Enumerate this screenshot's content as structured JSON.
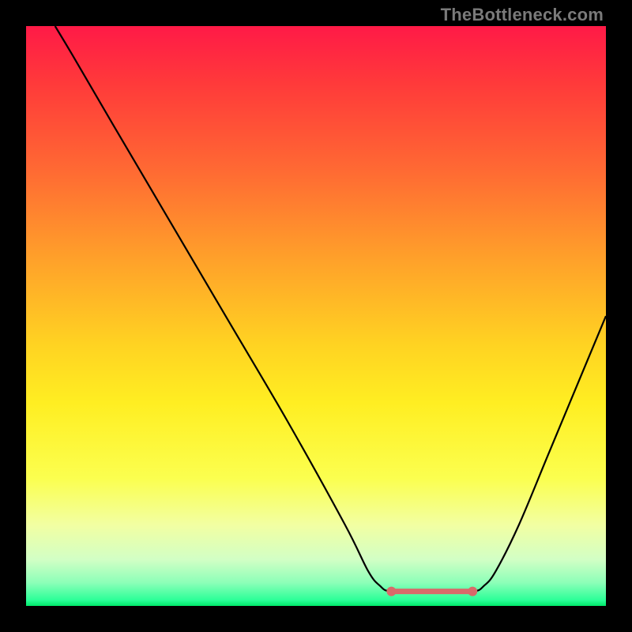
{
  "attribution": "TheBottleneck.com",
  "chart_data": {
    "type": "line",
    "title": "",
    "xlabel": "",
    "ylabel": "",
    "xlim": [
      0,
      100
    ],
    "ylim": [
      0,
      100
    ],
    "curve": [
      {
        "x": 5,
        "y": 100
      },
      {
        "x": 8,
        "y": 95
      },
      {
        "x": 15,
        "y": 83
      },
      {
        "x": 25,
        "y": 66
      },
      {
        "x": 35,
        "y": 49
      },
      {
        "x": 45,
        "y": 32
      },
      {
        "x": 55,
        "y": 14
      },
      {
        "x": 59,
        "y": 6
      },
      {
        "x": 61,
        "y": 3.5
      },
      {
        "x": 63,
        "y": 2.5
      },
      {
        "x": 70,
        "y": 2.5
      },
      {
        "x": 77,
        "y": 2.5
      },
      {
        "x": 79,
        "y": 3.5
      },
      {
        "x": 81,
        "y": 6
      },
      {
        "x": 85,
        "y": 14
      },
      {
        "x": 90,
        "y": 26
      },
      {
        "x": 95,
        "y": 38
      },
      {
        "x": 100,
        "y": 50
      }
    ],
    "flat_segment": {
      "x_start": 63,
      "x_end": 77,
      "y": 2.5,
      "color": "#d86a6a",
      "marker_radius_px": 6,
      "stroke_px": 7
    },
    "curve_stroke_px": 2.2,
    "curve_color": "#000000"
  }
}
